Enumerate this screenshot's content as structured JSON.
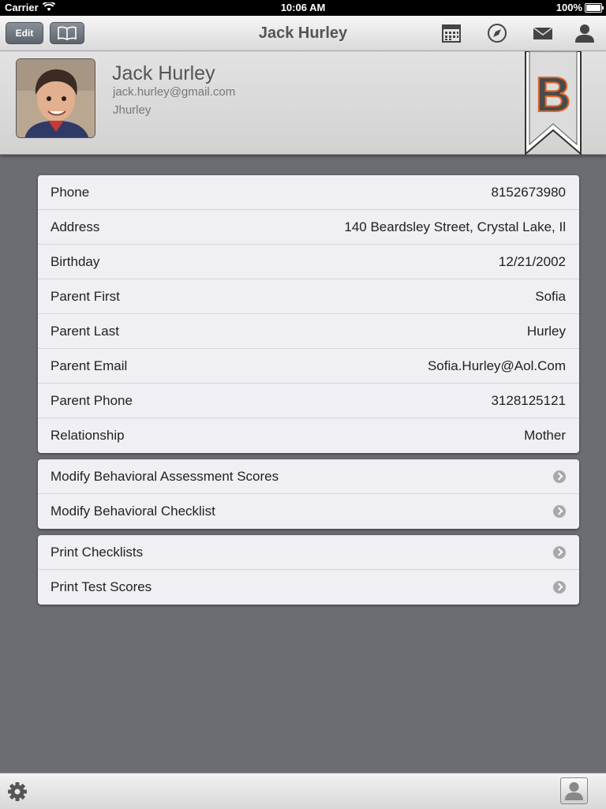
{
  "status_bar": {
    "carrier": "Carrier",
    "time": "10:06 AM",
    "battery": "100%"
  },
  "nav": {
    "title": "Jack Hurley",
    "edit_label": "Edit"
  },
  "profile": {
    "name": "Jack Hurley",
    "email": "jack.hurley@gmail.com",
    "username": "Jhurley",
    "badge_letter": "B"
  },
  "details": [
    {
      "label": "Phone",
      "value": "8152673980"
    },
    {
      "label": "Address",
      "value": "140 Beardsley Street, Crystal Lake, Il"
    },
    {
      "label": "Birthday",
      "value": "12/21/2002"
    },
    {
      "label": "Parent First",
      "value": "Sofia"
    },
    {
      "label": "Parent Last",
      "value": "Hurley"
    },
    {
      "label": "Parent Email",
      "value": "Sofia.Hurley@Aol.Com"
    },
    {
      "label": "Parent Phone",
      "value": "3128125121"
    },
    {
      "label": "Relationship",
      "value": "Mother"
    }
  ],
  "modify_actions": [
    {
      "label": "Modify Behavioral Assessment Scores"
    },
    {
      "label": "Modify Behavioral Checklist"
    }
  ],
  "print_actions": [
    {
      "label": "Print Checklists"
    },
    {
      "label": "Print Test Scores"
    }
  ],
  "colors": {
    "badge_orange": "#e0682a",
    "nav_button": "#6b717a",
    "background": "#6b6d72"
  }
}
